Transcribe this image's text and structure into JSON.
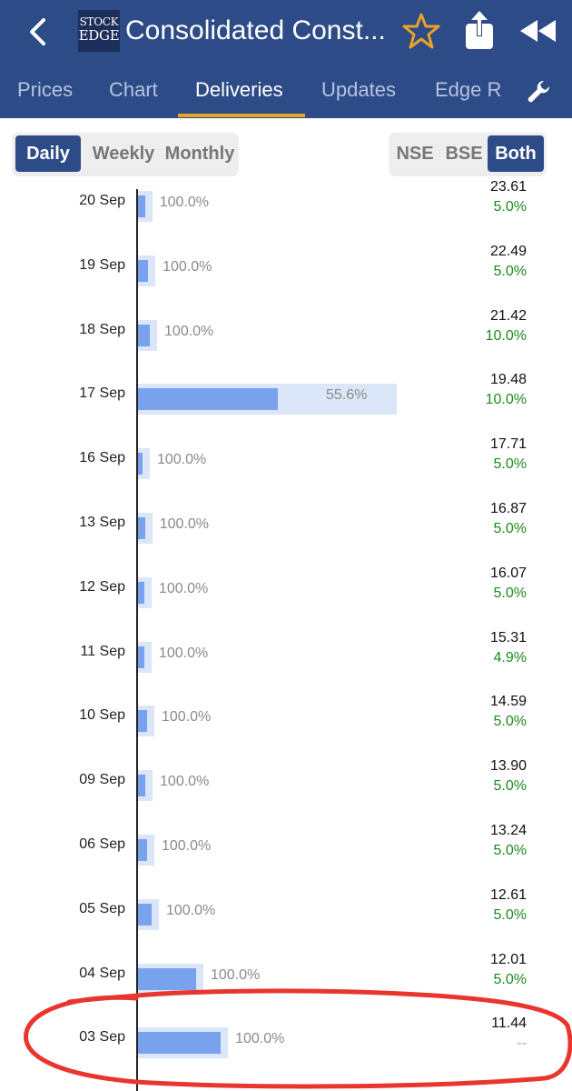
{
  "header": {
    "title": "Consolidated Const...",
    "logo_top": "STOCK",
    "logo_bottom": "EDGE",
    "colors": {
      "header_bg": "#2d4b87",
      "tab_indicator": "#e9a326"
    }
  },
  "tabs": [
    {
      "label": "Prices",
      "active": false
    },
    {
      "label": "Chart",
      "active": false
    },
    {
      "label": "Deliveries",
      "active": true
    },
    {
      "label": "Updates",
      "active": false
    },
    {
      "label": "Edge R",
      "active": false
    }
  ],
  "period_toggle": {
    "options": [
      "Daily",
      "Weekly",
      "Monthly"
    ],
    "selected": "Daily"
  },
  "exchange_toggle": {
    "options": [
      "NSE",
      "BSE",
      "Both"
    ],
    "selected": "Both"
  },
  "deliveries": [
    {
      "date": "20 Sep",
      "delivery_pct_label": "100.0%",
      "delivery_pct": 100.0,
      "volume_frac": 0.028,
      "price": "23.61",
      "change": "5.0%"
    },
    {
      "date": "19 Sep",
      "delivery_pct_label": "100.0%",
      "delivery_pct": 100.0,
      "volume_frac": 0.04,
      "price": "22.49",
      "change": "5.0%"
    },
    {
      "date": "18 Sep",
      "delivery_pct_label": "100.0%",
      "delivery_pct": 100.0,
      "volume_frac": 0.047,
      "price": "21.42",
      "change": "10.0%"
    },
    {
      "date": "17 Sep",
      "delivery_pct_label": "55.6%",
      "delivery_pct": 55.6,
      "volume_frac": 1.0,
      "price": "19.48",
      "change": "10.0%"
    },
    {
      "date": "16 Sep",
      "delivery_pct_label": "100.0%",
      "delivery_pct": 100.0,
      "volume_frac": 0.018,
      "price": "17.71",
      "change": "5.0%"
    },
    {
      "date": "13 Sep",
      "delivery_pct_label": "100.0%",
      "delivery_pct": 100.0,
      "volume_frac": 0.028,
      "price": "16.87",
      "change": "5.0%"
    },
    {
      "date": "12 Sep",
      "delivery_pct_label": "100.0%",
      "delivery_pct": 100.0,
      "volume_frac": 0.025,
      "price": "16.07",
      "change": "5.0%"
    },
    {
      "date": "11 Sep",
      "delivery_pct_label": "100.0%",
      "delivery_pct": 100.0,
      "volume_frac": 0.025,
      "price": "15.31",
      "change": "4.9%"
    },
    {
      "date": "10 Sep",
      "delivery_pct_label": "100.0%",
      "delivery_pct": 100.0,
      "volume_frac": 0.036,
      "price": "14.59",
      "change": "5.0%"
    },
    {
      "date": "09 Sep",
      "delivery_pct_label": "100.0%",
      "delivery_pct": 100.0,
      "volume_frac": 0.029,
      "price": "13.90",
      "change": "5.0%"
    },
    {
      "date": "06 Sep",
      "delivery_pct_label": "100.0%",
      "delivery_pct": 100.0,
      "volume_frac": 0.036,
      "price": "13.24",
      "change": "5.0%"
    },
    {
      "date": "05 Sep",
      "delivery_pct_label": "100.0%",
      "delivery_pct": 100.0,
      "volume_frac": 0.054,
      "price": "12.61",
      "change": "5.0%"
    },
    {
      "date": "04 Sep",
      "delivery_pct_label": "100.0%",
      "delivery_pct": 100.0,
      "volume_frac": 0.231,
      "price": "12.01",
      "change": "5.0%"
    },
    {
      "date": "03 Sep",
      "delivery_pct_label": "100.0%",
      "delivery_pct": 100.0,
      "volume_frac": 0.329,
      "price": "11.44",
      "change": "--"
    }
  ],
  "annotation": {
    "color": "#e8362e",
    "shape": "hand-drawn ellipse",
    "target": "03 Sep row"
  },
  "colors": {
    "delivered_bar": "#78a3ec",
    "traded_bar": "#dbe6f8",
    "positive_change": "#1d8a1d"
  }
}
